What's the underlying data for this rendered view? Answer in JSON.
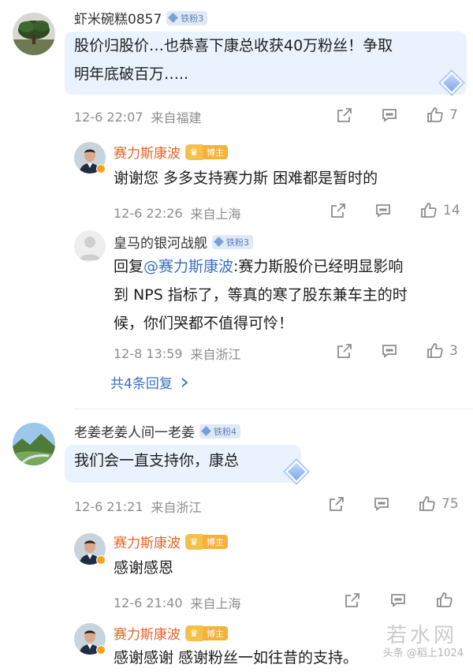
{
  "comments": [
    {
      "user": "虾米碗糕0857",
      "badge": "铁粉3",
      "text_lines": [
        "股价归股价…也恭喜下康总收获40万粉丝！争取",
        "明年底破百万….."
      ],
      "time": "12-6 22:07",
      "location": "来自福建",
      "likes": "7"
    },
    {
      "user": "赛力斯康波",
      "badge": "博主",
      "text_lines": [
        "谢谢您  多多支持赛力斯 困难都是暂时的"
      ],
      "time": "12-6 22:26",
      "location": "来自上海",
      "likes": "14"
    },
    {
      "user": "皇马的银河战舰",
      "badge": "铁粉3",
      "reply_prefix": "回复",
      "mention": "@赛力斯康波",
      "text_lines": [
        ":赛力斯股价已经明显影响",
        "到 NPS 指标了，等真的寒了股东兼车主的时",
        "候，你们哭都不值得可怜！"
      ],
      "time": "12-8 13:59",
      "location": "来自浙江",
      "likes": "3"
    },
    {
      "user": "老姜老姜人间一老姜",
      "badge": "铁粉4",
      "text_lines": [
        "我们会一直支持你，康总"
      ],
      "time": "12-6 21:21",
      "location": "来自浙江",
      "likes": "75"
    },
    {
      "user": "赛力斯康波",
      "badge": "博主",
      "text_lines": [
        "感谢感恩"
      ],
      "time": "12-6 21:40",
      "location": "来自上海",
      "likes": ""
    },
    {
      "user": "赛力斯康波",
      "badge": "博主",
      "text_lines": [
        "感谢感谢 感谢粉丝一如往昔的支持。"
      ]
    }
  ],
  "more_replies": "共4条回复",
  "watermark": "若水网",
  "watermark_source": "头条 @稻上1024",
  "icons": [
    "share-icon",
    "comment-icon",
    "like-icon",
    "crown-icon",
    "diamond-icon",
    "chevron-right-icon"
  ],
  "colors": {
    "host_name": "#e8622a",
    "link": "#3a6fc4",
    "bubble": "#eaf2fe",
    "meta": "#8d8d8d"
  }
}
